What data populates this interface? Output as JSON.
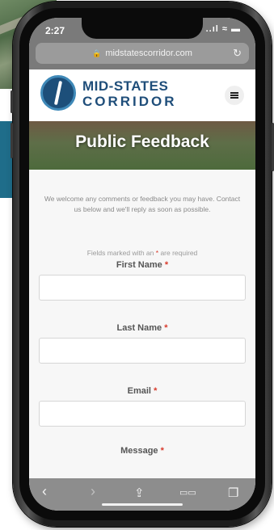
{
  "status_bar": {
    "time": "2:27",
    "signal": "..ıl",
    "wifi": "≈",
    "battery": "▬"
  },
  "browser": {
    "url": "midstatescorridor.com",
    "lock_icon": "lock-icon",
    "reload_icon": "reload-icon"
  },
  "site": {
    "logo_line1": "MID-STATES",
    "logo_line2": "CORRIDOR",
    "menu_icon": "hamburger-menu-icon"
  },
  "hero": {
    "title": "Public Feedback"
  },
  "form": {
    "intro": "We welcome any comments or feedback you may have. Contact us below and we'll reply as soon as possible.",
    "required_note_before": "Fields marked with an ",
    "required_star": "*",
    "required_note_after": " are required",
    "fields": [
      {
        "label": "First Name",
        "star": "*"
      },
      {
        "label": "Last Name",
        "star": "*"
      },
      {
        "label": "Email",
        "star": "*"
      },
      {
        "label": "Message",
        "star": "*"
      }
    ]
  },
  "toolbar": {
    "back": "‹",
    "forward": "›",
    "share": "⇪",
    "bookmarks": "▭▭",
    "tabs": "❐"
  },
  "colors": {
    "brand_blue": "#1f4e7a",
    "required_red": "#d93a2b"
  }
}
